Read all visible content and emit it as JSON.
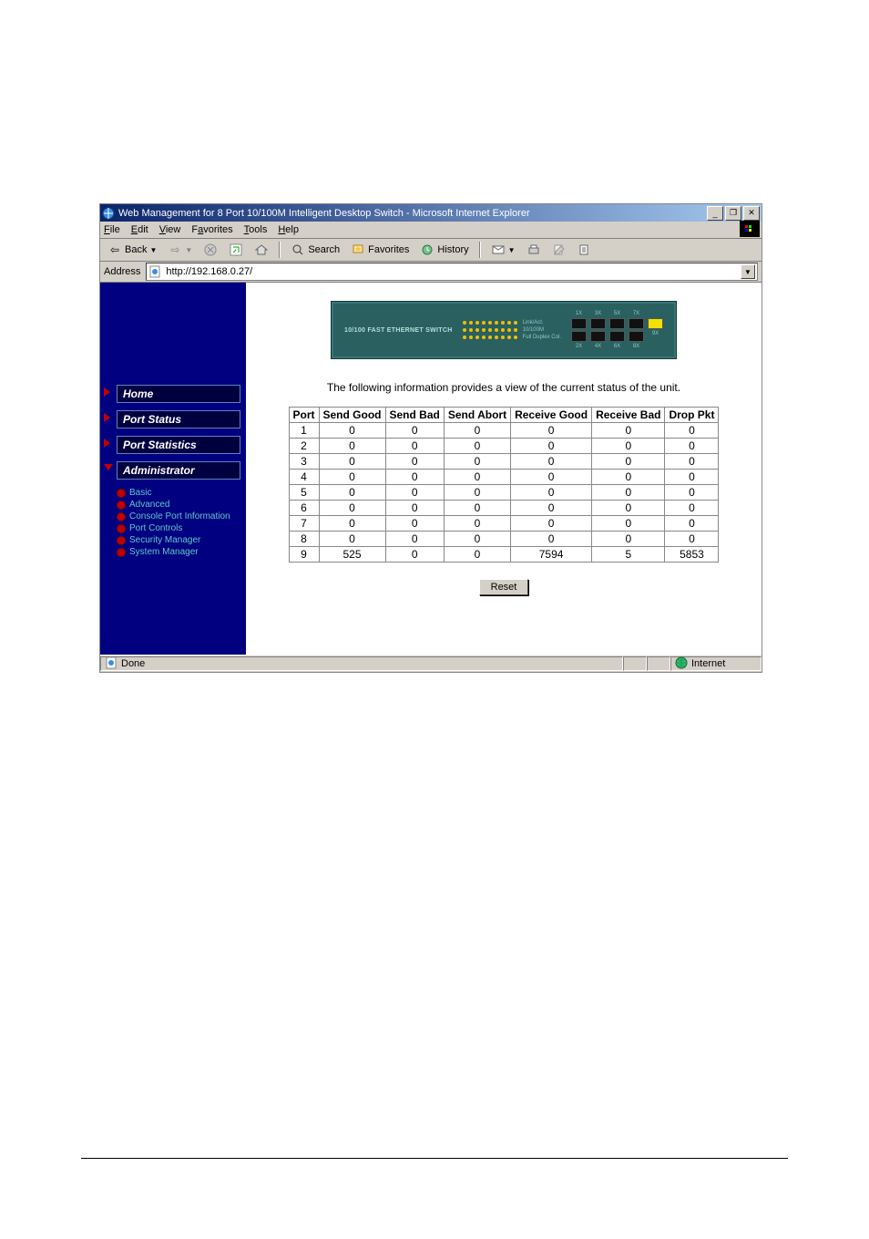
{
  "window": {
    "title": "Web Management for 8 Port 10/100M Intelligent Desktop Switch - Microsoft Internet Explorer",
    "min": "_",
    "max": "❐",
    "close": "✕"
  },
  "menubar": {
    "items": [
      "File",
      "Edit",
      "View",
      "Favorites",
      "Tools",
      "Help"
    ]
  },
  "toolbar": {
    "back": "Back",
    "search": "Search",
    "favorites": "Favorites",
    "history": "History"
  },
  "addressbar": {
    "label": "Address",
    "url": "http://192.168.0.27/"
  },
  "device": {
    "label": "10/100 FAST ETHERNET SWITCH",
    "legend1": "Link/Act.",
    "legend2": "10/100M",
    "legend3": "Full Duplex Col.",
    "top_ports": [
      "1X",
      "3X",
      "5X",
      "7X"
    ],
    "bot_ports": [
      "2X",
      "4X",
      "6X",
      "8X",
      "9X"
    ]
  },
  "sidebar": {
    "nav": [
      "Home",
      "Port Status",
      "Port Statistics",
      "Administrator"
    ],
    "sub": [
      "Basic",
      "Advanced",
      "Console Port Information",
      "Port Controls",
      "Security Manager",
      "System Manager"
    ]
  },
  "main": {
    "desc": "The following information provides a view of the current status of the unit.",
    "headers": [
      "Port",
      "Send Good",
      "Send Bad",
      "Send Abort",
      "Receive Good",
      "Receive Bad",
      "Drop Pkt"
    ],
    "rows": [
      [
        "1",
        "0",
        "0",
        "0",
        "0",
        "0",
        "0"
      ],
      [
        "2",
        "0",
        "0",
        "0",
        "0",
        "0",
        "0"
      ],
      [
        "3",
        "0",
        "0",
        "0",
        "0",
        "0",
        "0"
      ],
      [
        "4",
        "0",
        "0",
        "0",
        "0",
        "0",
        "0"
      ],
      [
        "5",
        "0",
        "0",
        "0",
        "0",
        "0",
        "0"
      ],
      [
        "6",
        "0",
        "0",
        "0",
        "0",
        "0",
        "0"
      ],
      [
        "7",
        "0",
        "0",
        "0",
        "0",
        "0",
        "0"
      ],
      [
        "8",
        "0",
        "0",
        "0",
        "0",
        "0",
        "0"
      ],
      [
        "9",
        "525",
        "0",
        "0",
        "7594",
        "5",
        "5853"
      ]
    ],
    "reset": "Reset"
  },
  "statusbar": {
    "status": "Done",
    "zone": "Internet"
  }
}
